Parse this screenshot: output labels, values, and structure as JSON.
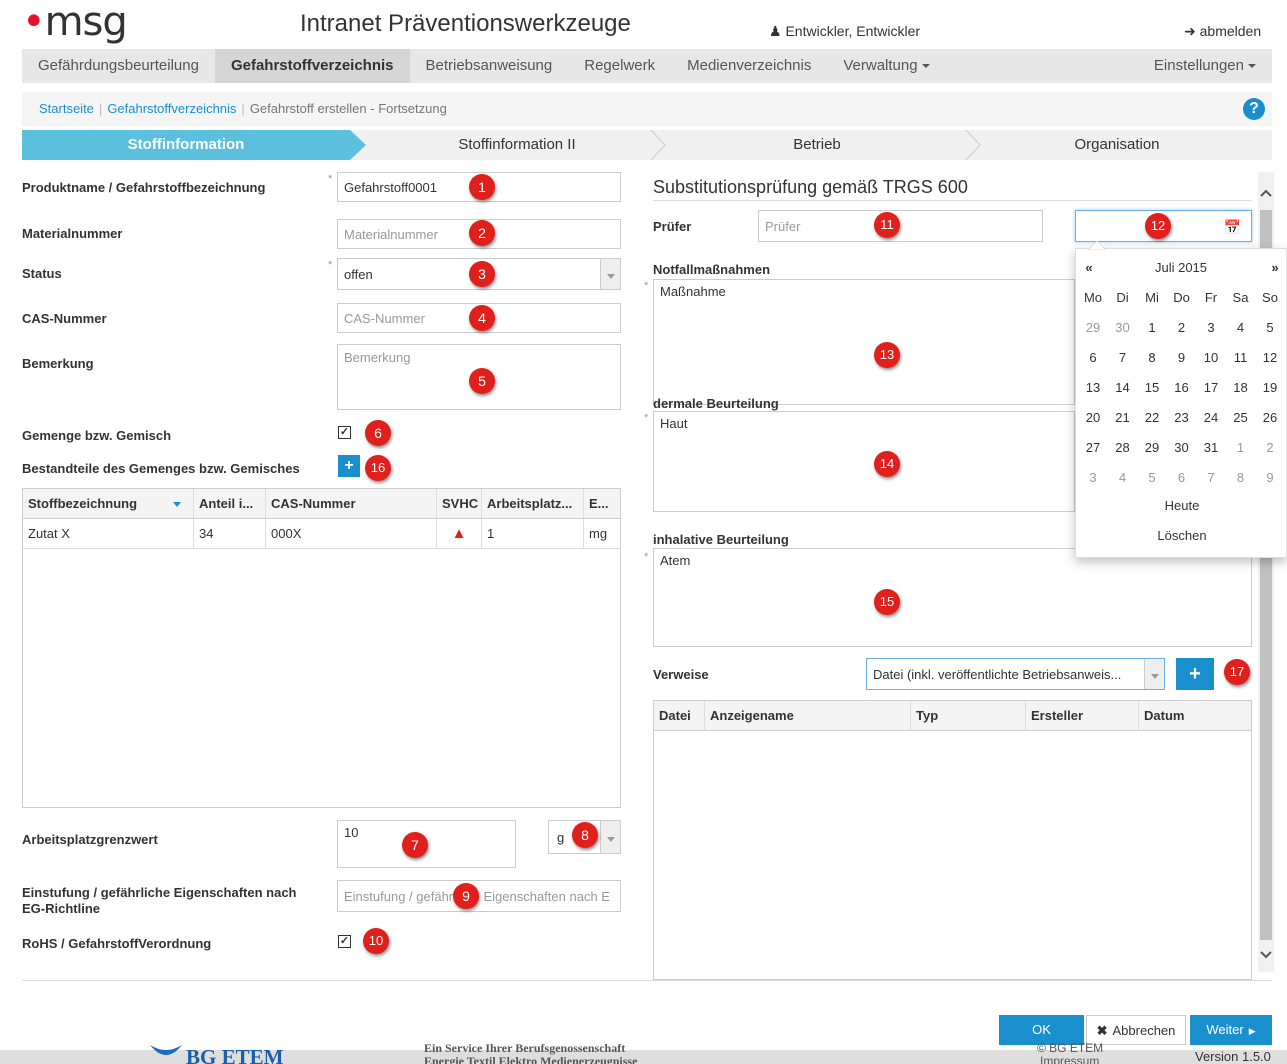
{
  "header": {
    "logo_text": "msg",
    "app_title": "Intranet Präventionswerkzeuge",
    "user_label": "Entwickler, Entwickler",
    "logout_label": "abmelden"
  },
  "nav": {
    "items": [
      "Gefährdungsbeurteilung",
      "Gefahrstoffverzeichnis",
      "Betriebsanweisung",
      "Regelwerk",
      "Medienverzeichnis",
      "Verwaltung"
    ],
    "settings": "Einstellungen"
  },
  "breadcrumb": {
    "home": "Startseite",
    "section": "Gefahrstoffverzeichnis",
    "current": "Gefahrstoff erstellen - Fortsetzung"
  },
  "help_label": "?",
  "wizard": {
    "steps": [
      "Stoffinformation",
      "Stoffinformation II",
      "Betrieb",
      "Organisation"
    ]
  },
  "form": {
    "produktname": {
      "label": "Produktname / Gefahrstoffbezeichnung",
      "value": "Gefahrstoff0001",
      "required": "*"
    },
    "materialnummer": {
      "label": "Materialnummer",
      "placeholder": "Materialnummer"
    },
    "status": {
      "label": "Status",
      "value": "offen",
      "required": "*"
    },
    "cas": {
      "label": "CAS-Nummer",
      "placeholder": "CAS-Nummer"
    },
    "bemerkung": {
      "label": "Bemerkung",
      "placeholder": "Bemerkung"
    },
    "gemenge": {
      "label": "Gemenge bzw. Gemisch",
      "checked": "✓"
    },
    "bestandteile": {
      "label": "Bestandteile des Gemenges bzw. Gemisches",
      "add": "+"
    },
    "arbeitsplatz": {
      "label": "Arbeitsplatzgrenzwert",
      "value": "10",
      "unit": "g"
    },
    "einstufung": {
      "label": "Einstufung / gefährliche Eigenschaften nach EG-Richtline",
      "placeholder": "Einstufung / gefährliche Eigenschaften nach E"
    },
    "rohs": {
      "label": "RoHS / GefahrstoffVerordnung",
      "checked": "✓"
    }
  },
  "bestandteile_table": {
    "headers": [
      "Stoffbezeichnung",
      "Anteil i...",
      "CAS-Nummer",
      "SVHC",
      "Arbeitsplatz...",
      "E..."
    ],
    "rows": [
      [
        "Zutat X",
        "34",
        "000X",
        "▲",
        "1",
        "mg"
      ]
    ]
  },
  "right": {
    "title": "Substitutionsprüfung gemäß TRGS 600",
    "pruefer": {
      "label": "Prüfer",
      "placeholder": "Prüfer"
    },
    "notfall": {
      "label": "Notfallmaßnahmen",
      "value": "Maßnahme",
      "required": "*"
    },
    "dermal": {
      "label": "dermale Beurteilung",
      "value": "Haut",
      "required": "*"
    },
    "inhalativ": {
      "label": "inhalative Beurteilung",
      "value": "Atem",
      "required": "*"
    },
    "verweise": {
      "label": "Verweise",
      "select_value": "Datei (inkl. veröffentlichte Betriebsanweis...",
      "add": "+"
    },
    "verweise_table": {
      "headers": [
        "Datei",
        "Anzeigename",
        "Typ",
        "Ersteller",
        "Datum"
      ]
    }
  },
  "datepicker": {
    "prev": "«",
    "next": "»",
    "month": "Juli 2015",
    "weekdays": [
      "Mo",
      "Di",
      "Mi",
      "Do",
      "Fr",
      "Sa",
      "So"
    ],
    "weeks": [
      [
        "29",
        "30",
        "1",
        "2",
        "3",
        "4",
        "5"
      ],
      [
        "6",
        "7",
        "8",
        "9",
        "10",
        "11",
        "12"
      ],
      [
        "13",
        "14",
        "15",
        "16",
        "17",
        "18",
        "19"
      ],
      [
        "20",
        "21",
        "22",
        "23",
        "24",
        "25",
        "26"
      ],
      [
        "27",
        "28",
        "29",
        "30",
        "31",
        "1",
        "2"
      ],
      [
        "3",
        "4",
        "5",
        "6",
        "7",
        "8",
        "9"
      ]
    ],
    "today": "Heute",
    "clear": "Löschen"
  },
  "badges": [
    "1",
    "2",
    "3",
    "4",
    "5",
    "6",
    "7",
    "8",
    "9",
    "10",
    "11",
    "12",
    "13",
    "14",
    "15",
    "16",
    "17"
  ],
  "buttons": {
    "ok": "OK",
    "cancel": "Abbrechen",
    "next": "Weiter"
  },
  "footer": {
    "brand": "BG ETEM",
    "service_line1": "Ein Service Ihrer Berufsgenossenschaft",
    "service_line2": "Energie Textil Elektro Medienerzeugnisse",
    "copyright": "© BG ETEM",
    "impressum": "Impressum",
    "version": "Version 1.5.0"
  },
  "colors": {
    "accent": "#1a8fce",
    "wizard_active": "#5bc0de",
    "badge": "#e0201c",
    "warning": "#e0201c"
  }
}
